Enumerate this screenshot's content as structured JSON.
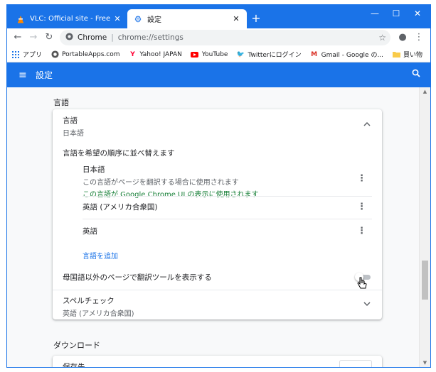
{
  "colors": {
    "accent": "#1a73e8",
    "background": "#f8f9fa",
    "green": "#188038"
  },
  "tabs": [
    {
      "title": "VLC: Official site - Free multimedi",
      "icon": "vlc-cone-icon",
      "close": "✕"
    },
    {
      "title": "設定",
      "icon": "gear-icon",
      "close": "✕"
    }
  ],
  "new_tab": "+",
  "window_controls": {
    "minimize": "—",
    "maximize": "☐",
    "close": "✕"
  },
  "toolbar": {
    "back": "←",
    "forward": "→",
    "reload": "↻",
    "chrome_label": "Chrome",
    "separator": "|",
    "url": "chrome://settings",
    "star": "☆",
    "profile": "●",
    "menu": "⋮"
  },
  "bookmarks": [
    {
      "label": "アプリ",
      "icon": "apps-grid-icon"
    },
    {
      "label": "PortableApps.com",
      "icon": "portableapps-icon"
    },
    {
      "label": "Yahoo! JAPAN",
      "icon": "yahoo-icon"
    },
    {
      "label": "YouTube",
      "icon": "youtube-icon"
    },
    {
      "label": "Twitterにログイン",
      "icon": "twitter-icon"
    },
    {
      "label": "Gmail - Google の...",
      "icon": "gmail-icon"
    },
    {
      "label": "買い物",
      "icon": "folder-icon"
    }
  ],
  "header": {
    "title": "設定",
    "menu_icon": "≡",
    "search_icon": "⚲"
  },
  "language_section": {
    "title": "言語",
    "language_row": {
      "label": "言語",
      "value": "日本語"
    },
    "reorder_label": "言語を希望の順序に並べ替えます",
    "languages": [
      {
        "name": "日本語",
        "line1": "この言語がページを翻訳する場合に使用されます",
        "line2": "この言語が Google Chrome UI の表示に使用されます"
      },
      {
        "name": "英語 (アメリカ合衆国)"
      },
      {
        "name": "英語"
      }
    ],
    "add_language": "言語を追加",
    "translate_toggle_label": "母国語以外のページで翻訳ツールを表示する",
    "spellcheck": {
      "label": "スペルチェック",
      "value": "英語 (アメリカ合衆国)"
    }
  },
  "download_section": {
    "title": "ダウンロード",
    "first_row": "保存先"
  }
}
